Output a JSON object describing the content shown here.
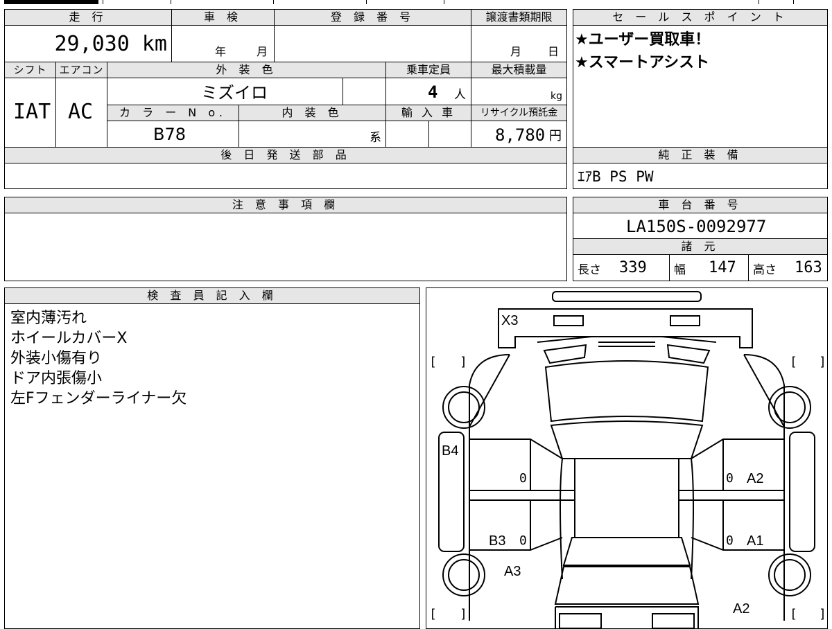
{
  "top_info": {
    "headers": {
      "mileage": "走 行",
      "inspection": "車 検",
      "registration": "登 録 番 号",
      "transfer_deadline": "譲渡書類期限",
      "shift": "シフト",
      "aircon": "エアコン",
      "exterior_color": "外 装 色",
      "capacity": "乗車定員",
      "max_load": "最大積載量",
      "color_no": "カ ラ ー N o.",
      "interior_color": "内 装 色",
      "import": "輸 入 車",
      "recycle": "リサイクル預託金",
      "later_parts": "後 日 発 送 部 品"
    },
    "mileage_value": "29,030 km",
    "inspection_year_unit": "年",
    "inspection_month_unit": "月",
    "deadline_month_unit": "月",
    "deadline_day_unit": "日",
    "shift_value": "IAT",
    "aircon_value": "AC",
    "exterior_value": "ミズイロ",
    "capacity_value": "4",
    "capacity_unit": "人",
    "max_load_unit": "kg",
    "color_no_value": "B78",
    "interior_unit": "系",
    "recycle_value": "8,780",
    "recycle_unit": "円"
  },
  "sales_points": {
    "header": "セ ー ル ス ポ イ ン ト",
    "lines": [
      "★ユーザー買取車！",
      "★スマートアシスト"
    ]
  },
  "genuine_equipment": {
    "header": "純 正 装 備",
    "value": "ｴｱB PS PW"
  },
  "caution": {
    "header": "注 意 事 項 欄"
  },
  "chassis": {
    "header": "車 台 番 号",
    "value": "LA150S-0092977"
  },
  "specs": {
    "header": "諸 元",
    "length_label": "長さ",
    "length_value": "339",
    "width_label": "幅",
    "width_value": "147",
    "height_label": "高さ",
    "height_value": "163"
  },
  "inspector_notes": {
    "header": "検 査 員 記 入 欄",
    "lines": [
      "室内薄汚れ",
      "ホイールカバーX",
      "外装小傷有り",
      "ドア内張傷小",
      "左Fフェンダーライナー欠"
    ]
  },
  "damage_map": {
    "marks": {
      "front": "X3",
      "left_front_door": "B4",
      "right_front_door": "A2",
      "left_rear_door": "B3",
      "right_rear_door": "A1",
      "left_rear_quarter": "A3",
      "right_rear_quarter": "A2"
    },
    "zero": "0",
    "bracket_open": "[",
    "bracket_close": "]"
  }
}
